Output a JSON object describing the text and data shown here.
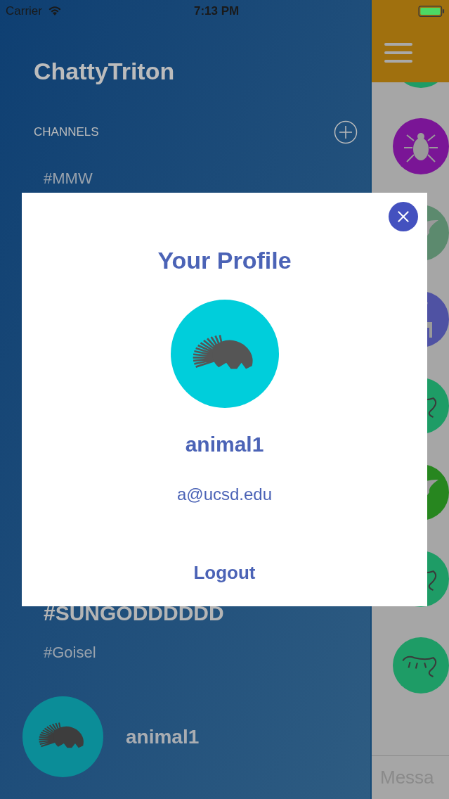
{
  "status_bar": {
    "carrier": "Carrier",
    "time": "7:13 PM"
  },
  "sidebar": {
    "title": "ChattyTriton",
    "section": "CHANNELS",
    "channels": [
      {
        "name": "#MMW",
        "selected": false
      },
      {
        "name": "#SUNGODDDDDD",
        "selected": true
      },
      {
        "name": "#Goisel",
        "selected": false
      }
    ],
    "user": {
      "name": "animal1"
    }
  },
  "chat": {
    "avatars": [
      {
        "kind": "hidden",
        "color": "#1e9c66"
      },
      {
        "kind": "bug",
        "color": "#7a1596"
      },
      {
        "kind": "bird",
        "color": "#5c8a6e"
      },
      {
        "kind": "giraffe",
        "color": "#4f52a3"
      },
      {
        "kind": "lizard",
        "color": "#1e9c66"
      },
      {
        "kind": "bird",
        "color": "#27861f"
      },
      {
        "kind": "lizard",
        "color": "#1e9c66"
      },
      {
        "kind": "lizard",
        "color": "#1e9c66"
      }
    ],
    "message_placeholder": "Messa"
  },
  "profile_dialog": {
    "title": "Your Profile",
    "username": "animal1",
    "email": "a@ucsd.edu",
    "logout": "Logout"
  }
}
